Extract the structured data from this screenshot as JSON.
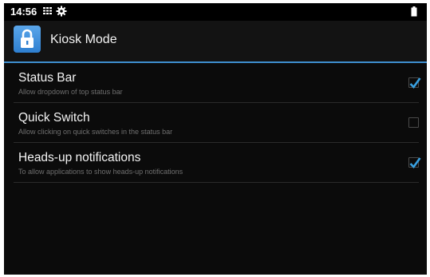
{
  "status_bar": {
    "time": "14:56",
    "icons": [
      "notification-grid-icon",
      "settings-gear-icon",
      "battery-icon"
    ]
  },
  "app_bar": {
    "title": "Kiosk Mode",
    "icon": "lock-app-icon"
  },
  "settings": [
    {
      "title": "Status Bar",
      "summary": "Allow dropdown of top status bar",
      "checked": true
    },
    {
      "title": "Quick Switch",
      "summary": "Allow clicking on quick switches in the status bar",
      "checked": false
    },
    {
      "title": "Heads-up notifications",
      "summary": "To allow applications to show heads-up notifications",
      "checked": true
    }
  ],
  "colors": {
    "accent": "#3f8fcf",
    "checkmark": "#39a0e0",
    "background": "#0b0b0b"
  }
}
